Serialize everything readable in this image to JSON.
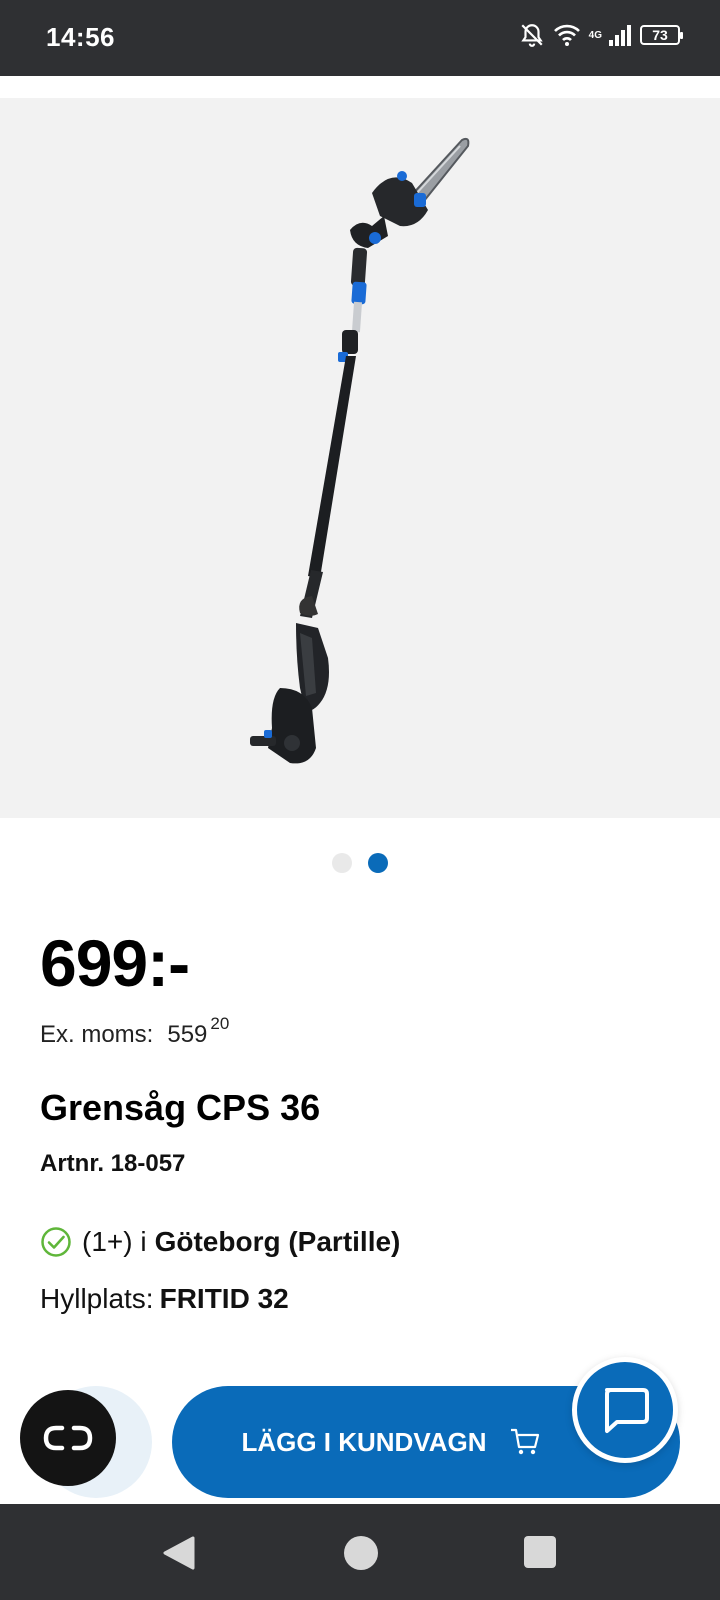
{
  "status_bar": {
    "time": "14:56",
    "network": "4G",
    "battery": "73"
  },
  "gallery": {
    "active_index": 2,
    "count": 2
  },
  "product": {
    "price": "699:-",
    "ex_moms_label": "Ex. moms:",
    "ex_moms_whole": "559",
    "ex_moms_cents": "20",
    "title": "Grensåg CPS 36",
    "artnr": "Artnr. 18-057",
    "stock_count": "(1+) i",
    "stock_store": "Göteborg (Partille)",
    "shelf_label": "Hyllplats:",
    "shelf_value": "FRITID 32"
  },
  "actions": {
    "add_to_cart": "LÄGG I KUNDVAGN"
  },
  "colors": {
    "accent": "#0a6bb9",
    "check": "#5fb63a",
    "bar": "#2f3033"
  }
}
